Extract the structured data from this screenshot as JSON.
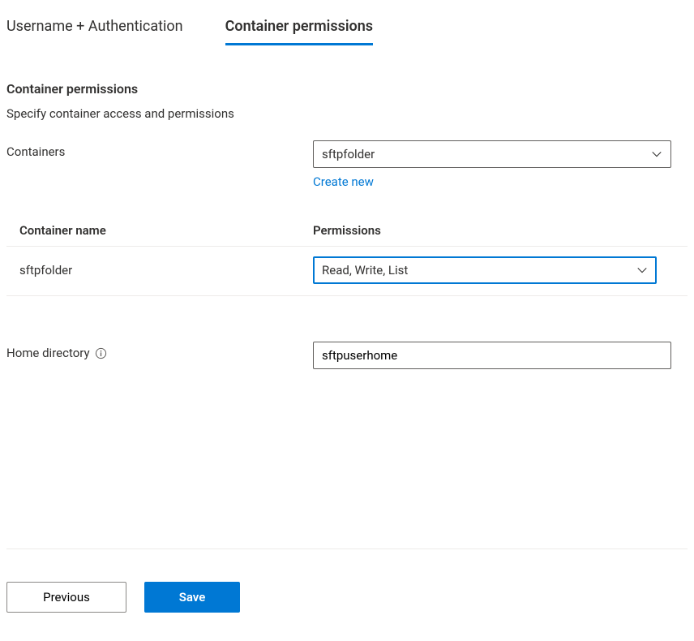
{
  "tabs": {
    "auth": "Username + Authentication",
    "perm": "Container permissions"
  },
  "section": {
    "title": "Container permissions",
    "desc": "Specify container access and permissions"
  },
  "containers": {
    "label": "Containers",
    "selected": "sftpfolder",
    "create_new": "Create new"
  },
  "table": {
    "col_name": "Container name",
    "col_perm": "Permissions",
    "rows": [
      {
        "name": "sftpfolder",
        "permissions": "Read, Write, List"
      }
    ]
  },
  "home_dir": {
    "label": "Home directory",
    "value": "sftpuserhome"
  },
  "footer": {
    "previous": "Previous",
    "save": "Save"
  }
}
